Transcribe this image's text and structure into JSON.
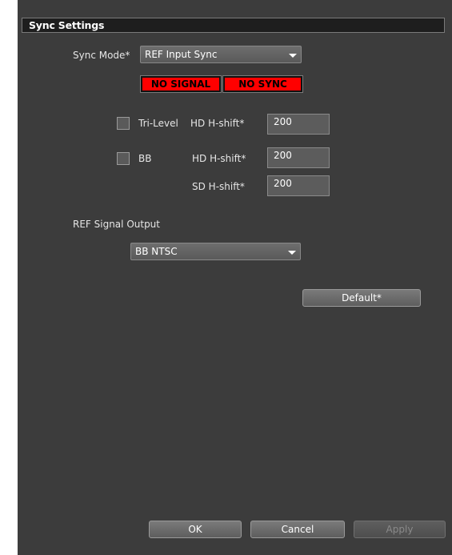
{
  "title": "Sync Settings",
  "sync_mode": {
    "label": "Sync Mode*",
    "value": "REF Input Sync"
  },
  "status": {
    "signal": "NO SIGNAL",
    "sync": "NO SYNC",
    "color": "#ff0000"
  },
  "tri_level": {
    "checkbox_label": "Tri-Level",
    "hd_label": "HD H-shift*",
    "hd_value": "200",
    "checked": false
  },
  "bb": {
    "checkbox_label": "BB",
    "hd_label": "HD H-shift*",
    "hd_value": "200",
    "sd_label": "SD H-shift*",
    "sd_value": "200",
    "checked": false
  },
  "ref_output": {
    "label": "REF Signal Output",
    "value": "BB NTSC"
  },
  "buttons": {
    "default": "Default*",
    "ok": "OK",
    "cancel": "Cancel",
    "apply": "Apply"
  }
}
